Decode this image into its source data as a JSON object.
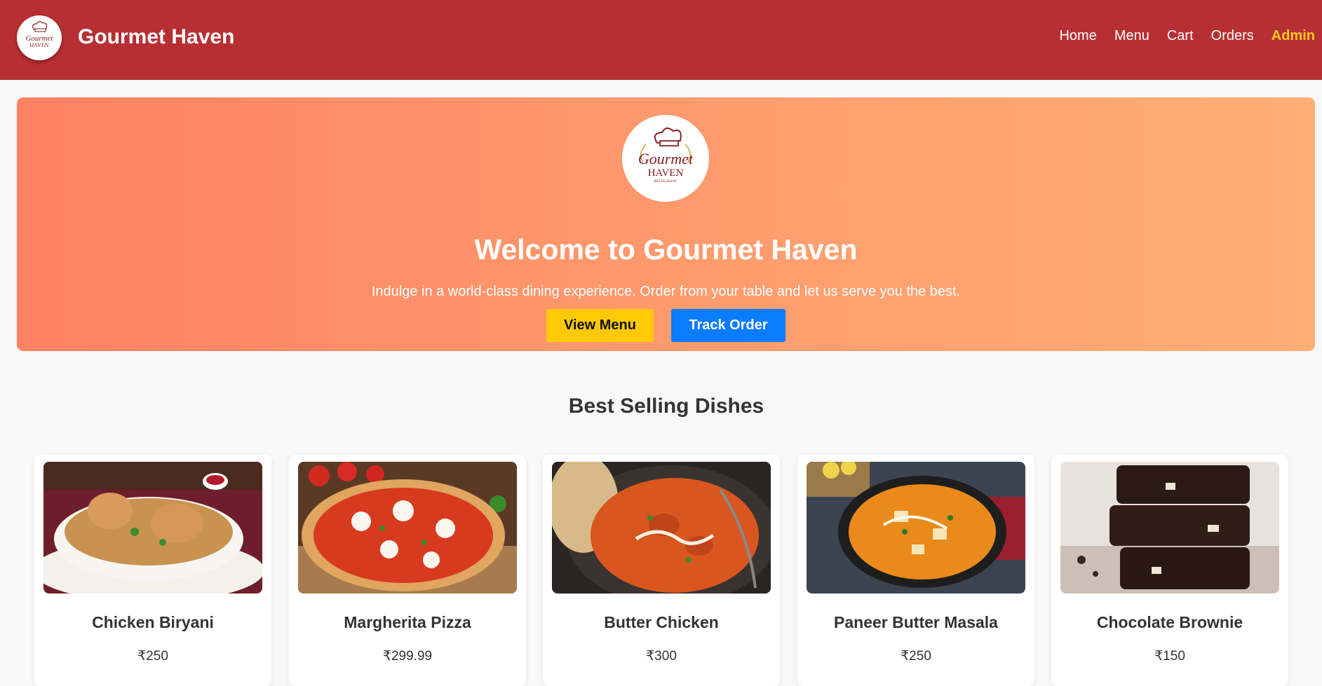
{
  "header": {
    "title": "Gourmet Haven",
    "nav": [
      "Home",
      "Menu",
      "Cart",
      "Orders",
      "Admin"
    ]
  },
  "hero": {
    "title": "Welcome to Gourmet Haven",
    "subtitle": "Indulge in a world-class dining experience. Order from your table and let us serve you the best.",
    "view_menu_label": "View Menu",
    "track_order_label": "Track Order"
  },
  "logo": {
    "line1": "Gourmet",
    "line2": "HAVEN",
    "line3": "RESTAURANT"
  },
  "section": {
    "title": "Best Selling Dishes"
  },
  "dishes": [
    {
      "name": "Chicken Biryani",
      "price": "₹250",
      "image": "chicken-biryani-photo"
    },
    {
      "name": "Margherita Pizza",
      "price": "₹299.99",
      "image": "margherita-pizza-photo"
    },
    {
      "name": "Butter Chicken",
      "price": "₹300",
      "image": "butter-chicken-photo"
    },
    {
      "name": "Paneer Butter Masala",
      "price": "₹250",
      "image": "paneer-butter-masala-photo"
    },
    {
      "name": "Chocolate Brownie",
      "price": "₹150",
      "image": "chocolate-brownie-photo"
    }
  ],
  "colors": {
    "header_bg": "#b82f33",
    "admin_link": "#ffc81e",
    "hero_gradient_start": "#ff8163",
    "hero_gradient_end": "#ffae75",
    "view_menu_bg": "#ffca05",
    "track_order_bg": "#0a7cff"
  }
}
